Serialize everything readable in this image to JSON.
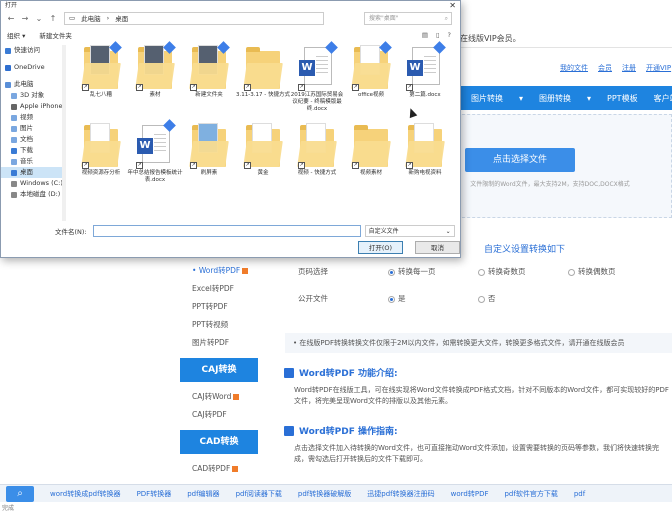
{
  "webpage": {
    "vip_text": "接在线版VIP会员。",
    "top_links": [
      "我的文件",
      "会员",
      "注册",
      "开通VIP"
    ],
    "nav_items": [
      "图片转换",
      "图册转换",
      "PPT模板",
      "客户端"
    ],
    "choose_button": "点击选择文件",
    "upload_hint": "文件限制的Word文件，最大支持2M，支持DOC,DOCX格式",
    "custom_title": "自定义设置转换如下",
    "sidebar": {
      "items_top": [
        {
          "label": "Word转PDF",
          "active": true,
          "tag": true
        },
        {
          "label": "Excel转PDF",
          "active": false,
          "tag": false
        },
        {
          "label": "PPT转PDF",
          "active": false,
          "tag": false
        },
        {
          "label": "PPT转视频",
          "active": false,
          "tag": false
        },
        {
          "label": "图片转PDF",
          "active": false,
          "tag": false
        }
      ],
      "head_caj": "CAJ转换",
      "items_caj": [
        {
          "label": "CAJ转Word",
          "tag": true
        },
        {
          "label": "CAJ转PDF",
          "tag": false
        }
      ],
      "head_cad": "CAD转换",
      "items_cad": [
        {
          "label": "CAD转PDF",
          "tag": true
        }
      ]
    },
    "page_range_label": "页码选择",
    "page_range_options": [
      "转换每一页",
      "转换奇数页",
      "转换偶数页"
    ],
    "public_label": "公开文件",
    "public_options": [
      "是",
      "否"
    ],
    "notice": "在线版PDF转换转换文件仅限于2M以内文件，如需转换更大文件，转换更多格式文件，请开通在线版会员",
    "intro_title": "Word转PDF 功能介绍:",
    "intro_body": "Word转PDF在线版工具，可在线实现将Word文件转换成PDF格式文档，针对不同版本的Word文件，都可实现较好的PDF文件，将完美呈现Word文件的排版以及其他元素。",
    "guide_title": "Word转PDF 操作指南:",
    "guide_body": "点击选择文件加入待转换的Word文件，也可直接拖动Word文件添加，设置需要转换的页码等参数，我们将快速转换完成，需勾选后打开转换后的文件下载即可。",
    "bottom_keywords": [
      "word转换成pdf转换器",
      "PDF转换器",
      "pdf编辑器",
      "pdf阅读器下载",
      "pdf转换器破解版",
      "迅捷pdf转换器注册码",
      "word转PDF",
      "pdf软件官方下载",
      "pdf"
    ],
    "status": "完成"
  },
  "dialog": {
    "title": "打开",
    "breadcrumb": [
      "此电脑",
      "桌面"
    ],
    "search_placeholder": "搜索\"桌面\"",
    "organize": "组织 ▾",
    "new_folder": "新建文件夹",
    "nav_items": [
      {
        "label": "快速访问",
        "indent": false,
        "sel": false,
        "color": "#3a7bd5"
      },
      {
        "label": "OneDrive",
        "indent": false,
        "sel": false,
        "color": "#2f6fd0"
      },
      {
        "label": "此电脑",
        "indent": false,
        "sel": false,
        "color": "#5a8fd8"
      },
      {
        "label": "3D 对象",
        "indent": true,
        "sel": false,
        "color": "#7aa7e0"
      },
      {
        "label": "Apple iPhone",
        "indent": true,
        "sel": false,
        "color": "#666666"
      },
      {
        "label": "视频",
        "indent": true,
        "sel": false,
        "color": "#7aa7e0"
      },
      {
        "label": "图片",
        "indent": true,
        "sel": false,
        "color": "#7aa7e0"
      },
      {
        "label": "文档",
        "indent": true,
        "sel": false,
        "color": "#7aa7e0"
      },
      {
        "label": "下载",
        "indent": true,
        "sel": false,
        "color": "#3a7bd5"
      },
      {
        "label": "音乐",
        "indent": true,
        "sel": false,
        "color": "#7aa7e0"
      },
      {
        "label": "桌面",
        "indent": true,
        "sel": true,
        "color": "#3a7bd5"
      },
      {
        "label": "Windows (C:)",
        "indent": true,
        "sel": false,
        "color": "#888888"
      },
      {
        "label": "本地磁盘 (D:)",
        "indent": true,
        "sel": false,
        "color": "#888888"
      }
    ],
    "files": [
      {
        "label": "乱七八糟",
        "type": "folder-pic",
        "pin": true
      },
      {
        "label": "素材",
        "type": "folder-pic",
        "pin": true
      },
      {
        "label": "新建文件夹",
        "type": "folder-pic",
        "pin": true
      },
      {
        "label": "3.11-3.17 - 快捷方式",
        "type": "folder",
        "pin": false
      },
      {
        "label": "2019江苏国际贸易会议纪要 - 终稿模版最终.docx",
        "type": "doc",
        "pin": true
      },
      {
        "label": "office视频",
        "type": "folder-doc",
        "pin": true
      },
      {
        "label": "第二篇.docx",
        "type": "doc",
        "pin": true
      },
      {
        "label": "视频资源存分析",
        "type": "folder-doc",
        "pin": false
      },
      {
        "label": "年中总结报告模板统计表.docx",
        "type": "doc",
        "pin": true
      },
      {
        "label": "刷屏素",
        "type": "folder-blue",
        "pin": false
      },
      {
        "label": "黄金",
        "type": "folder-doc",
        "pin": false
      },
      {
        "label": "视频 - 快捷方式",
        "type": "folder-doc",
        "pin": false
      },
      {
        "label": "视频素材",
        "type": "folder",
        "pin": false
      },
      {
        "label": "新购电视资料",
        "type": "folder-doc",
        "pin": false
      }
    ],
    "filename_label": "文件名(N):",
    "filename_value": "",
    "filetype": "自定义文件",
    "open_button": "打开(O)",
    "cancel_button": "取消"
  }
}
